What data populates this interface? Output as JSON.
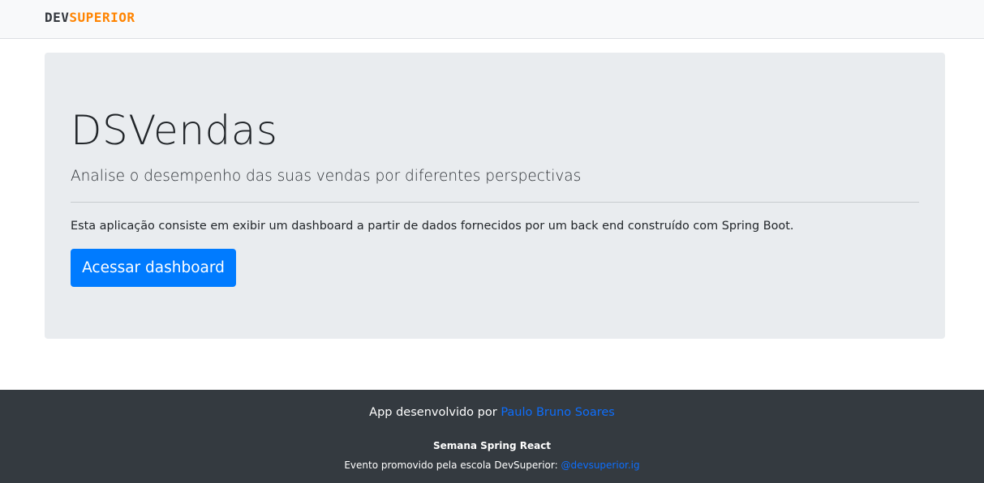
{
  "navbar": {
    "logo_part1": "DEV",
    "logo_part2": "SUPERIOR"
  },
  "jumbotron": {
    "title": "DSVendas",
    "lead": "Analise o desempenho das suas vendas por diferentes perspectivas",
    "description": "Esta aplicação consiste em exibir um dashboard a partir de dados fornecidos por um back end construído com Spring Boot.",
    "button_label": "Acessar dashboard"
  },
  "footer": {
    "line1_prefix": "App desenvolvido por ",
    "author_link": "Paulo Bruno Soares",
    "line2": "Semana Spring React",
    "line3_prefix": "Evento promovido pela escola DevSuperior: ",
    "instagram_link": "@devsuperior.ig"
  },
  "colors": {
    "accent": "#007bff",
    "brand_orange": "#ff8400",
    "navbar_bg": "#f8f9fa",
    "jumbotron_bg": "#e9ecef",
    "footer_bg": "#343a40",
    "link": "#0d6efd"
  }
}
